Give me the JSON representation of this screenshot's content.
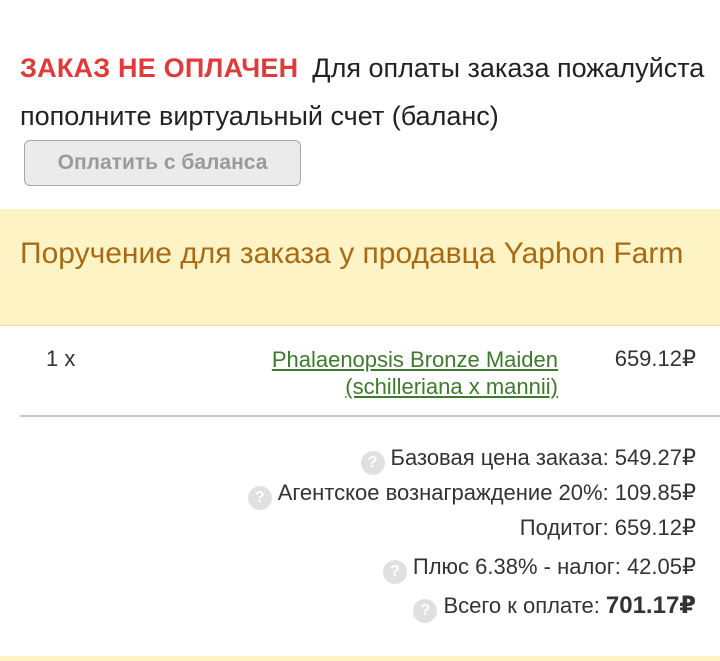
{
  "status": {
    "unpaid_label": "ЗАКАЗ НЕ ОПЛАЧЕН",
    "message": "Для оплаты заказа пожалуйста пополните виртуальный счет (баланс)",
    "pay_button": "Оплатить с баланса"
  },
  "order": {
    "title": "Поручение для заказа у продавца Yaphon Farm"
  },
  "items": [
    {
      "qty": "1 x",
      "name": "Phalaenopsis Bronze Maiden (schilleriana x mannii)",
      "price": "659.12₽"
    }
  ],
  "summary": {
    "base_label": "Базовая цена заказа:",
    "base_value": "549.27₽",
    "agent_label": "Агентское вознаграждение 20%:",
    "agent_value": "109.85₽",
    "subtotal_label": "Подитог:",
    "subtotal_value": "659.12₽",
    "tax_label": "Плюс 6.38% - налог:",
    "tax_value": "42.05₽",
    "total_label": "Всего к оплате:",
    "total_value": "701.17₽",
    "help_glyph": "?"
  },
  "colors": {
    "unpaid": "#e03a3a",
    "header_bg": "#fdf3c5",
    "header_text": "#a86a12",
    "link": "#3e7a2e"
  }
}
